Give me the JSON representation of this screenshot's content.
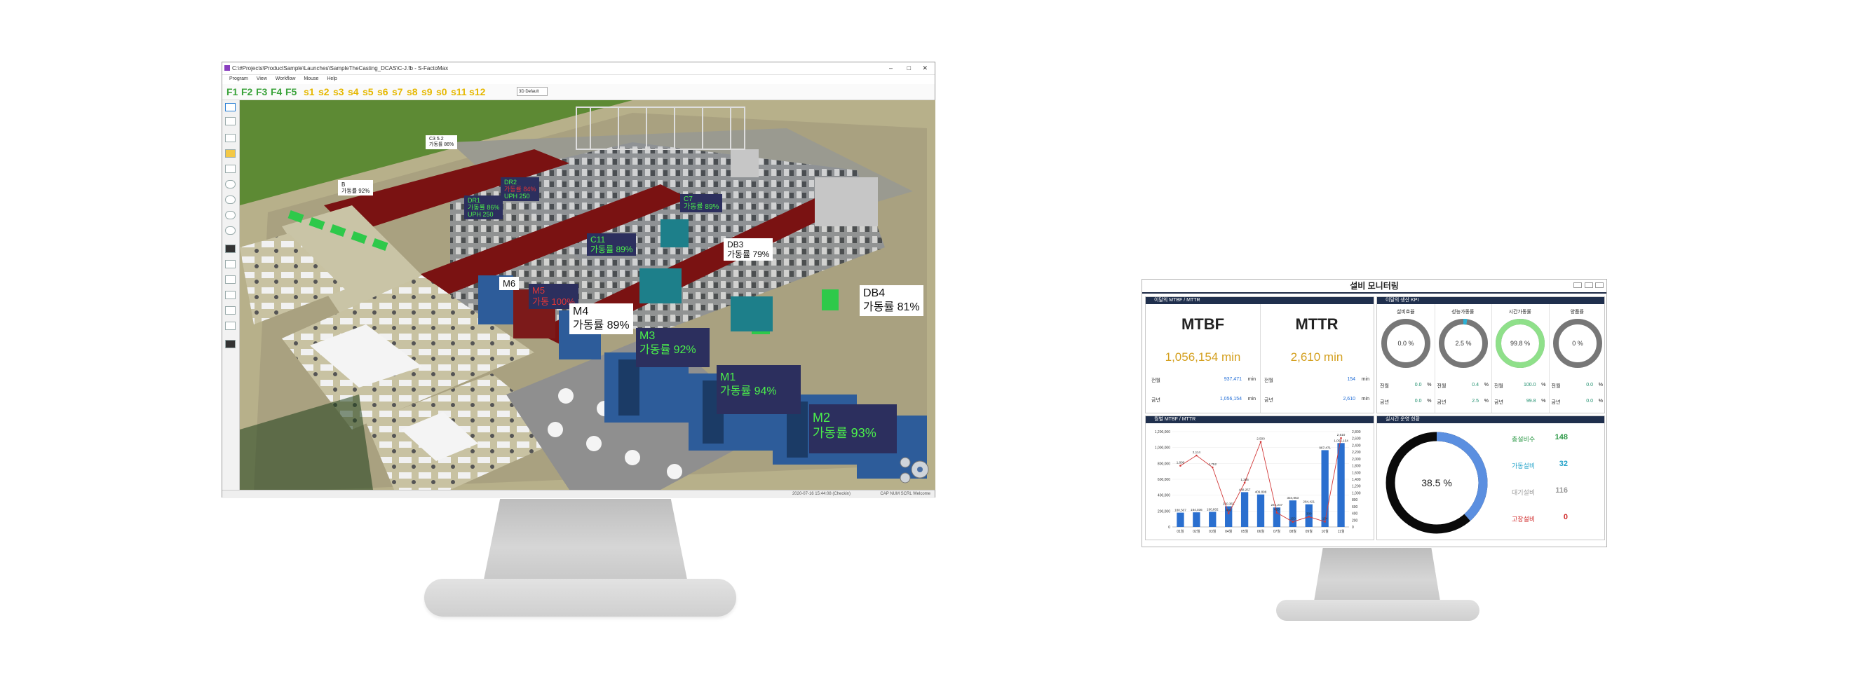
{
  "left_window": {
    "title": "C:\\#Projects\\ProductSample\\Launches\\SampleTheCasting_DCAS\\C-J.fb - S-FactoMax",
    "menu": [
      "Program",
      "View",
      "Workflow",
      "Mouse",
      "Help"
    ],
    "window_controls": {
      "minimize": "–",
      "maximize": "□",
      "close": "✕"
    },
    "fkeys_green": [
      "F1",
      "F2",
      "F3",
      "F4",
      "F5"
    ],
    "fkeys_yellow": [
      "s1",
      "s2",
      "s3",
      "s4",
      "s5",
      "s6",
      "s7",
      "s8",
      "s9",
      "s0",
      "s11",
      "s12"
    ],
    "view_select": "3D Default",
    "status_left": "2020-07-16 15:44:08 (Checkin)",
    "status_right": "CAP  NUM  SCRL  Welcome",
    "labels": [
      {
        "id": "B",
        "line1": "B",
        "line2": "가동률 92%"
      },
      {
        "id": "C3",
        "line1": "C3 5.2",
        "line2": "가동률 86%"
      },
      {
        "id": "DR2",
        "line1": "DR2",
        "line2": "가동률 84%",
        "line3": "UPH 250"
      },
      {
        "id": "DR1",
        "line1": "DR1",
        "line2": "가동률 86%",
        "line3": "UPH 250"
      },
      {
        "id": "C7",
        "line1": "C7",
        "line2": "가동률 89%"
      },
      {
        "id": "C11",
        "line1": "C11",
        "line2": "가동률 89%"
      },
      {
        "id": "DB3",
        "line1": "DB3",
        "line2": "가동률 79%"
      },
      {
        "id": "M6",
        "line1": "M6"
      },
      {
        "id": "M5",
        "line1": "M5",
        "line2": "가동 100%"
      },
      {
        "id": "M4",
        "line1": "M4",
        "line2": "가동률 89%"
      },
      {
        "id": "DB4",
        "line1": "DB4",
        "line2": "가동률 81%"
      },
      {
        "id": "M3",
        "line1": "M3",
        "line2": "가동률 92%"
      },
      {
        "id": "M1",
        "line1": "M1",
        "line2": "가동률 94%"
      },
      {
        "id": "M2",
        "line1": "M2",
        "line2": "가동률 93%"
      }
    ]
  },
  "dashboard": {
    "title": "설비 모니터링",
    "sections": {
      "mtbf_mttr": "이달의 MTBF / MTTR",
      "kpi": "이달의 생산 KPI",
      "monthly": "월별 MTBF / MTTR",
      "status": "실시간 운영 현황"
    },
    "mtbf": {
      "label": "MTBF",
      "value": "1,056,154 min",
      "prev_label": "전월",
      "prev": "937,471",
      "year_label": "금년",
      "year": "1,056,154",
      "unit": "min"
    },
    "mttr": {
      "label": "MTTR",
      "value": "2,610 min",
      "prev_label": "전월",
      "prev": "154",
      "year_label": "금년",
      "year": "2,610",
      "unit": "min"
    },
    "kpis": [
      {
        "name": "설비효율",
        "value": "0.0 %",
        "fill": 0.0,
        "prev_label": "전월",
        "prev": "0.0",
        "year_label": "금년",
        "year": "0.0",
        "unit": "%"
      },
      {
        "name": "성능가동률",
        "value": "2.5 %",
        "fill": 0.025,
        "prev_label": "전월",
        "prev": "0.4",
        "year_label": "금년",
        "year": "2.5",
        "unit": "%"
      },
      {
        "name": "시간가동률",
        "value": "99.8 %",
        "fill": 0.998,
        "prev_label": "전월",
        "prev": "100.0",
        "year_label": "금년",
        "year": "99.8",
        "unit": "%"
      },
      {
        "name": "양품률",
        "value": "0 %",
        "fill": 0.0,
        "prev_label": "전월",
        "prev": "0.0",
        "year_label": "금년",
        "year": "0.0",
        "unit": "%"
      }
    ],
    "status": {
      "donut_value": "38.5 %",
      "donut_fraction": 0.385,
      "items": [
        {
          "label": "총설비수",
          "value": "148",
          "color": "#2e9a48"
        },
        {
          "label": "가동설비",
          "value": "32",
          "color": "#22a2c9"
        },
        {
          "label": "대기설비",
          "value": "116",
          "color": "#9a9a9a"
        },
        {
          "label": "고장설비",
          "value": "0",
          "color": "#d02a2a"
        }
      ]
    }
  },
  "chart_data": {
    "type": "bar",
    "categories": [
      "01월",
      "02월",
      "03월",
      "04월",
      "05월",
      "06월",
      "07월",
      "08월",
      "09월",
      "10월",
      "11월"
    ],
    "series": [
      {
        "name": "MTBF",
        "type": "bar",
        "values": [
          180000,
          184000,
          190000,
          260000,
          438000,
          409000,
          245000,
          334000,
          285000,
          967000,
          1056000
        ]
      },
      {
        "name": "MTTR",
        "type": "line",
        "values": [
          1800,
          2100,
          1750,
          400,
          1300,
          2500,
          420,
          150,
          300,
          154,
          2610
        ]
      }
    ],
    "bar_labels": [
      "180,507",
      "184,036",
      "190,802",
      "260,363",
      "438,257",
      "409,898",
      "245,247",
      "334,853",
      "284,421",
      "967,471",
      "1,056,154"
    ],
    "line_labels": [
      "1,800",
      "2,114",
      "1,752",
      "400",
      "1,305",
      "2,500",
      "420",
      "150",
      "300",
      "154",
      "2,610"
    ],
    "ylim_left": [
      0,
      1200000
    ],
    "yticks_left": [
      "0",
      "200,000",
      "400,000",
      "600,000",
      "800,000",
      "1,000,000",
      "1,200,000"
    ],
    "ylim_right": [
      0,
      2800
    ],
    "yticks_right": [
      "0",
      "200",
      "400",
      "600",
      "800",
      "1,000",
      "1,200",
      "1,400",
      "1,600",
      "1,800",
      "2,000",
      "2,200",
      "2,400",
      "2,600",
      "2,800"
    ],
    "colors": {
      "bar": "#2a6fcf",
      "line": "#d23a3a"
    }
  }
}
